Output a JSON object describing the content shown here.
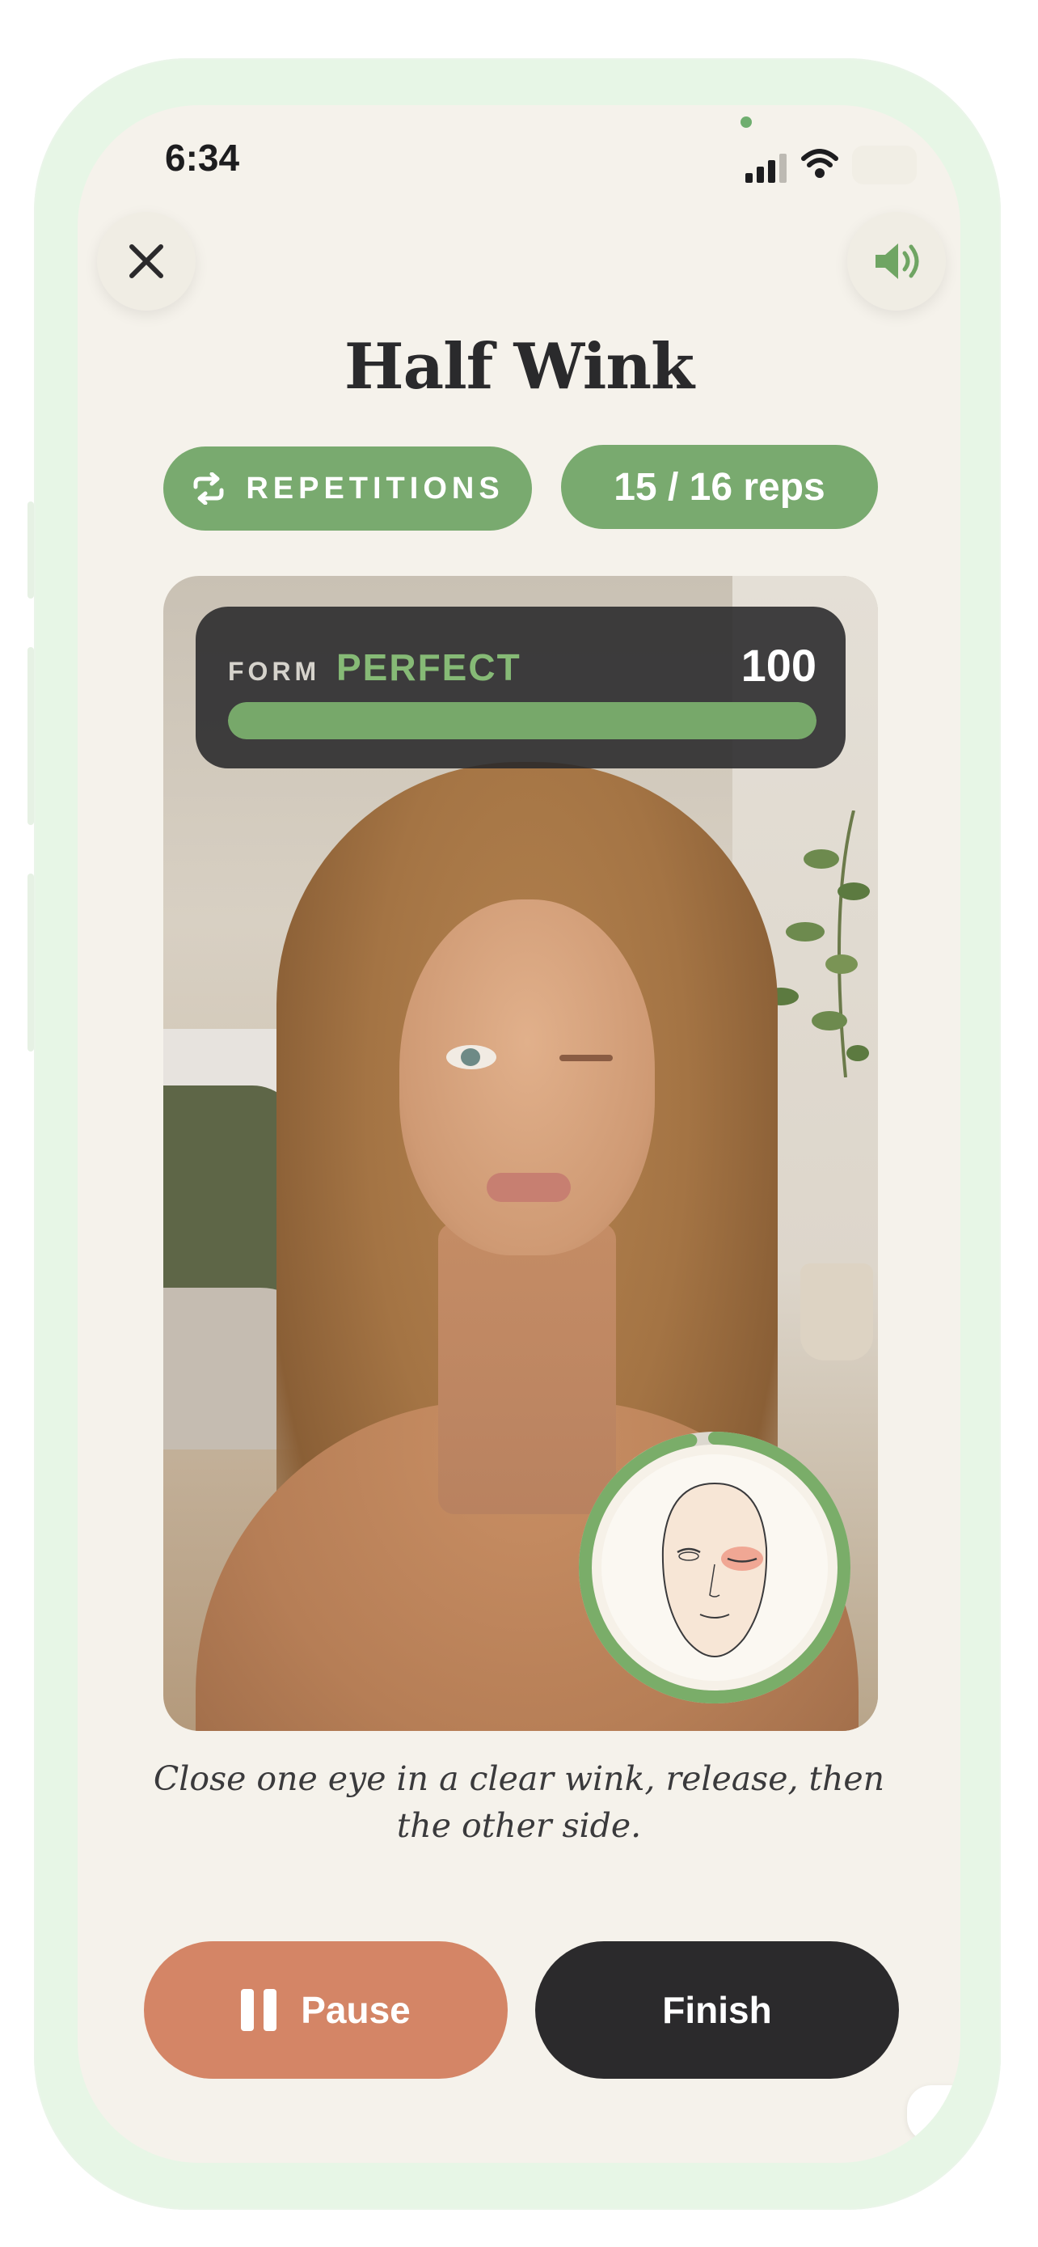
{
  "status_bar": {
    "time": "6:34"
  },
  "header": {
    "close_icon": "close-icon",
    "sound_icon": "speaker-icon"
  },
  "exercise": {
    "title": "Half Wink",
    "mode_label": "REPETITIONS",
    "mode_icon": "repeat-icon",
    "reps_label": "15 / 16 reps"
  },
  "form": {
    "label": "FORM",
    "status": "PERFECT",
    "score": "100",
    "progress": 1.0
  },
  "face_guide": {
    "icon": "face-wink-guide-icon",
    "ring_progress": 0.97
  },
  "instruction": "Close one eye in a clear wink, release, then the other side.",
  "controls": {
    "pause_label": "Pause",
    "finish_label": "Finish"
  },
  "colors": {
    "accent_green": "#79aa6f",
    "pause_orange": "#d48566",
    "finish_dark": "#2b2a2c",
    "background": "#f5f2eb"
  }
}
